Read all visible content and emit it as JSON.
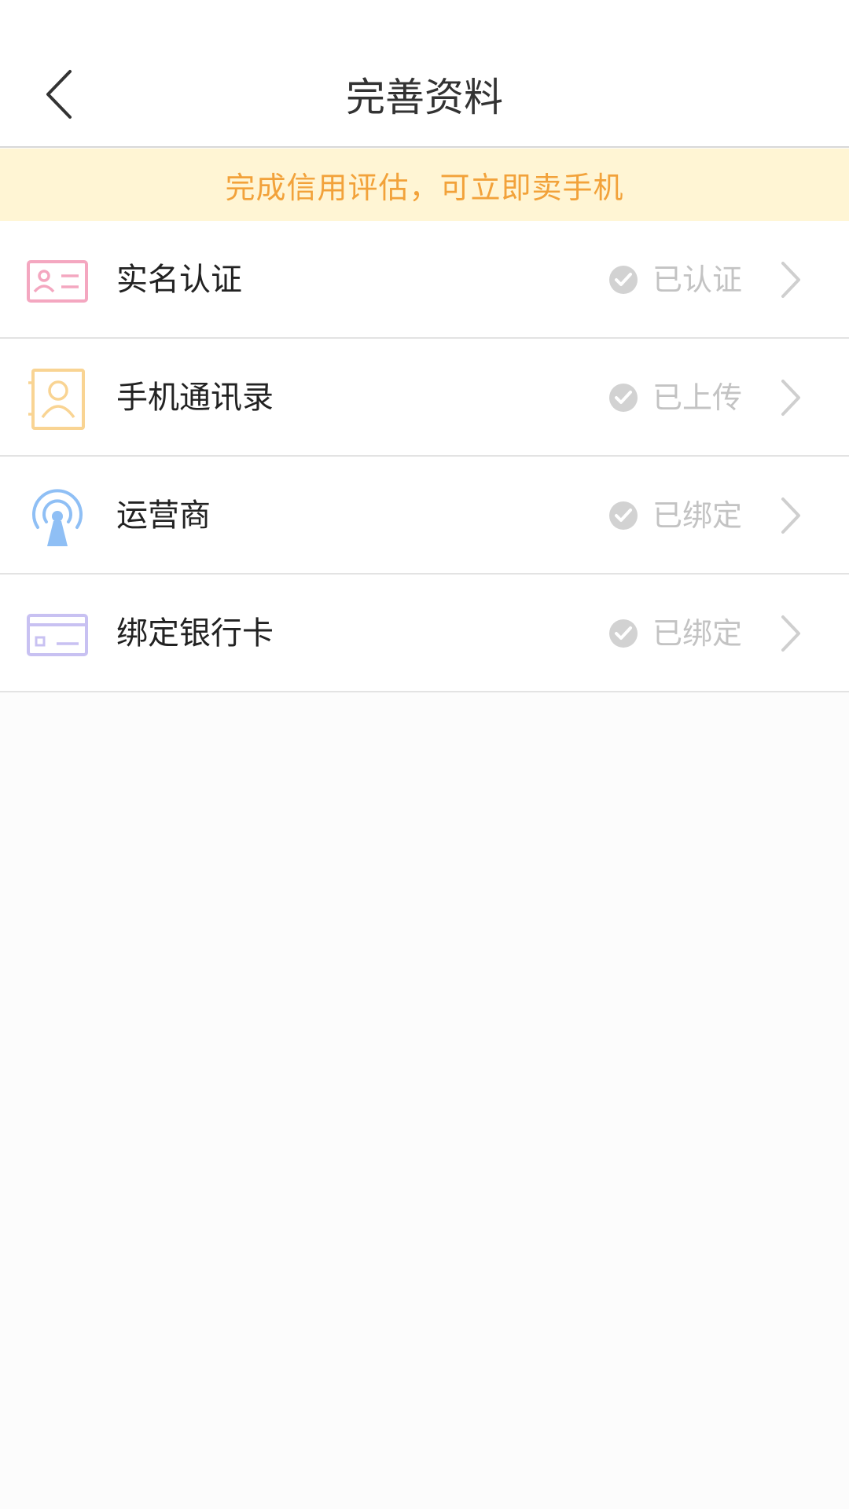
{
  "header": {
    "title": "完善资料"
  },
  "banner": {
    "text": "完成信用评估，可立即卖手机"
  },
  "colors": {
    "banner_text": "#f2a23a",
    "banner_bg": "#fff5d4",
    "status_text": "#c3c3c3"
  },
  "items": [
    {
      "label": "实名认证",
      "status": "已认证",
      "icon": "id-card-icon",
      "icon_color": "#f4a7c0"
    },
    {
      "label": "手机通讯录",
      "status": "已上传",
      "icon": "contacts-book-icon",
      "icon_color": "#f9d493"
    },
    {
      "label": "运营商",
      "status": "已绑定",
      "icon": "signal-tower-icon",
      "icon_color": "#8fbff5"
    },
    {
      "label": "绑定银行卡",
      "status": "已绑定",
      "icon": "bank-card-icon",
      "icon_color": "#c8c1f2"
    }
  ]
}
